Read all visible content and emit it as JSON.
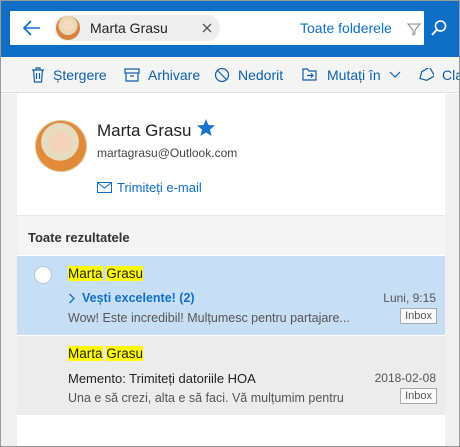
{
  "search": {
    "contact_chip_name": "Marta Grasu",
    "scope_label": "Toate folderele"
  },
  "toolbar": {
    "delete_label": "Ștergere",
    "archive_label": "Arhivare",
    "junk_label": "Nedorit",
    "move_label": "Mutați în",
    "categorize_label": "Cla"
  },
  "contact": {
    "name": "Marta Grasu",
    "email": "martagrasu@Outlook.com",
    "send_email_label": "Trimiteți e-mail"
  },
  "results": {
    "header": "Toate rezultatele",
    "messages": [
      {
        "sender_first": "Marta",
        "sender_last": "Grasu",
        "subject": "Vești excelente! (2)",
        "date": "Luni, 9:15",
        "preview": "Wow! Este incredibil! Mulțumesc pentru partajare...",
        "folder": "Inbox",
        "selected": true
      },
      {
        "sender_first": "Marta",
        "sender_last": "Grasu",
        "subject": "Memento: Trimiteți datoriile HOA",
        "date": "2018-02-08",
        "preview": "Una e să crezi, alta e să faci. Vă mulțumim pentru",
        "folder": "Inbox",
        "selected": false
      }
    ]
  },
  "colors": {
    "accent": "#0f6fc6",
    "selected_row": "#c7dff5",
    "highlight": "#ffff00"
  }
}
